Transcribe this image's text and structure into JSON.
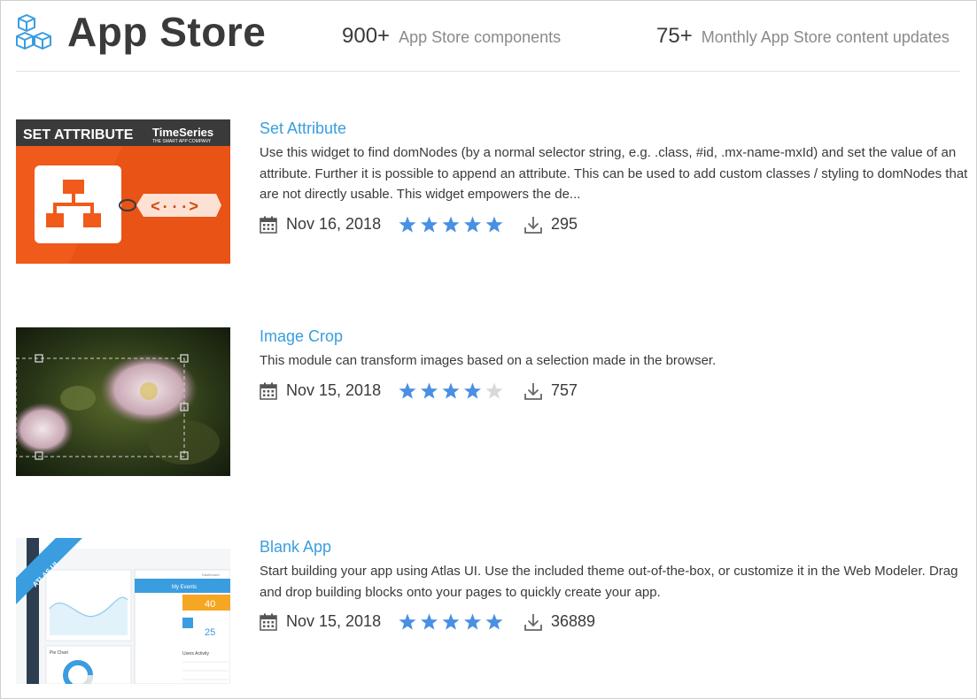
{
  "header": {
    "title": "App Store",
    "logo_icon": "cubes-icon",
    "stats": [
      {
        "number": "900+",
        "label": "App Store components"
      },
      {
        "number": "75+",
        "label": "Monthly App Store content updates"
      }
    ]
  },
  "colors": {
    "accent": "#3a9de0",
    "star_filled": "#4a90e2",
    "star_empty": "#d9d9d9",
    "thumb_orange": "#f05a1a"
  },
  "items": [
    {
      "title": "Set Attribute",
      "description": "Use this widget to find domNodes (by a normal selector string, e.g. .class, #id, .mx-name-mxId) and set the value of an attribute. Further it is possible to append an attribute. This can be used to add custom classes / styling to domNodes that are not directly usable. This widget empowers the de...",
      "date": "Nov 16, 2018",
      "rating": 5,
      "downloads": "295",
      "thumb": {
        "heading": "SET ATTRIBUTE",
        "brand": "TimeSeries",
        "brand_sub": "THE SMART APP COMPANY",
        "tag": "<···>"
      }
    },
    {
      "title": "Image Crop",
      "description": "This module can transform images based on a selection made in the browser.",
      "date": "Nov 15, 2018",
      "rating": 4,
      "downloads": "757",
      "thumb": {}
    },
    {
      "title": "Blank App",
      "description": "Start building your app using Atlas UI. Use the included theme out-of-the-box, or customize it in the Web Modeler. Drag and drop building blocks onto your pages to quickly create your app.",
      "date": "Nov 15, 2018",
      "rating": 5,
      "downloads": "36889",
      "thumb": {
        "ribbon": "ATLAS UI",
        "card_title": "My Events",
        "dashboard": "Dashboard",
        "users_activity": "Users Activity",
        "stat_a": "40",
        "stat_b": "25",
        "pie_label": "Pie Chart"
      }
    }
  ]
}
